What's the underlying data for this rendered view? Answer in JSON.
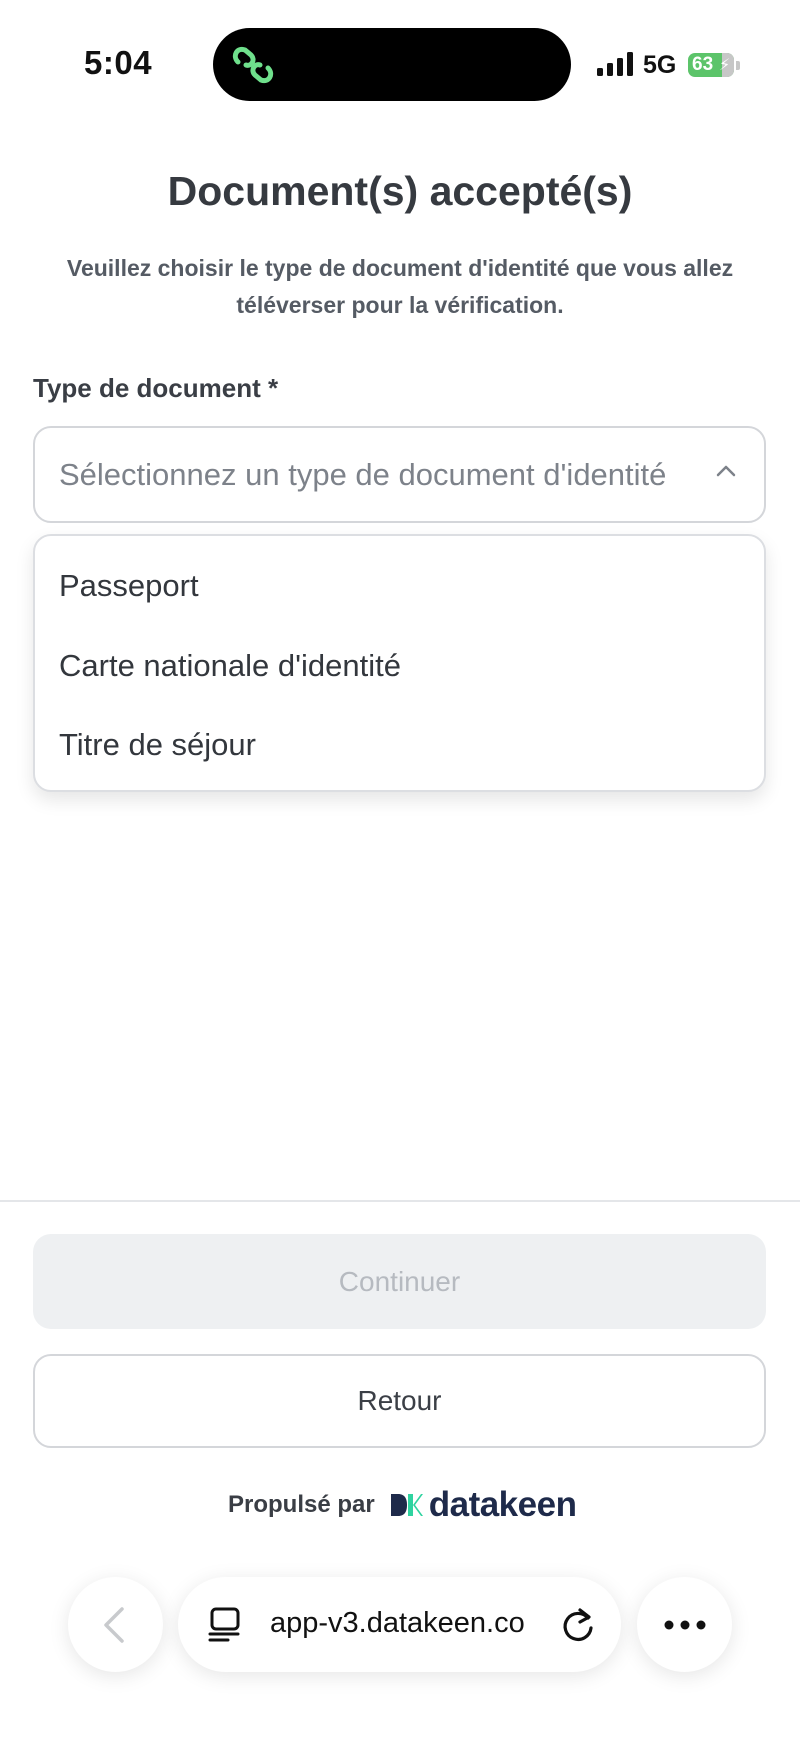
{
  "status_bar": {
    "time": "5:04",
    "network": "5G",
    "battery": "63"
  },
  "page": {
    "title": "Document(s) accepté(s)",
    "subtitle": "Veuillez choisir le type de document d'identité que vous allez téléverser pour la vérification."
  },
  "form": {
    "label": "Type de document *",
    "placeholder": "Sélectionnez un type de document d'identité",
    "options": [
      {
        "label": "Passeport"
      },
      {
        "label": "Carte nationale d'identité"
      },
      {
        "label": "Titre de séjour"
      }
    ]
  },
  "buttons": {
    "continue": "Continuer",
    "back": "Retour"
  },
  "footer": {
    "powered_by": "Propulsé par",
    "brand": "datakeen"
  },
  "browser": {
    "url": "app-v3.datakeen.co"
  },
  "colors": {
    "brand_green": "#2fd3a0",
    "brand_navy": "#1e2a4a",
    "battery": "#5cc46a"
  }
}
